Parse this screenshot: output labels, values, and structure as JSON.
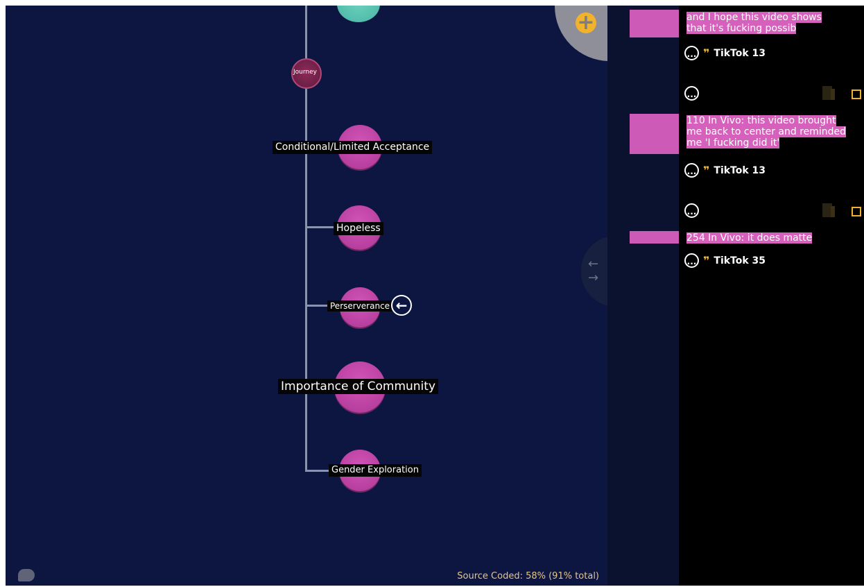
{
  "map": {
    "nodes": [
      {
        "id": "journey",
        "label": "Journey"
      },
      {
        "id": "conditional",
        "label": "Conditional/Limited Acceptance"
      },
      {
        "id": "hopeless",
        "label": "Hopeless"
      },
      {
        "id": "perserverance",
        "label": "Perserverance"
      },
      {
        "id": "community",
        "label": "Importance of Community"
      },
      {
        "id": "gender",
        "label": "Gender Exploration"
      }
    ],
    "add_icon": "plus-icon",
    "back_icon": "arrow-left-icon",
    "swap_icons": [
      "arrow-left-icon",
      "arrow-right-icon"
    ],
    "status": "Source Coded: 58% (91% total)"
  },
  "panel": {
    "quotes": [
      {
        "text_line1": " and I hope this video shows",
        "text_line2": "that it's fucking possib",
        "source": "TikTok 13"
      },
      {
        "text_line1": "110 In Vivo: this video brought",
        "text_line2": "me back to center and reminded",
        "text_line3": "me 'I fucking did it'",
        "source": "TikTok 13"
      },
      {
        "text_line1": "254 In Vivo: it does matte",
        "source": "TikTok 35"
      }
    ],
    "comment_glyph": "...",
    "quote_glyph": "❞",
    "accent": "#cd5ab6",
    "highlight": "#f1b32e"
  }
}
